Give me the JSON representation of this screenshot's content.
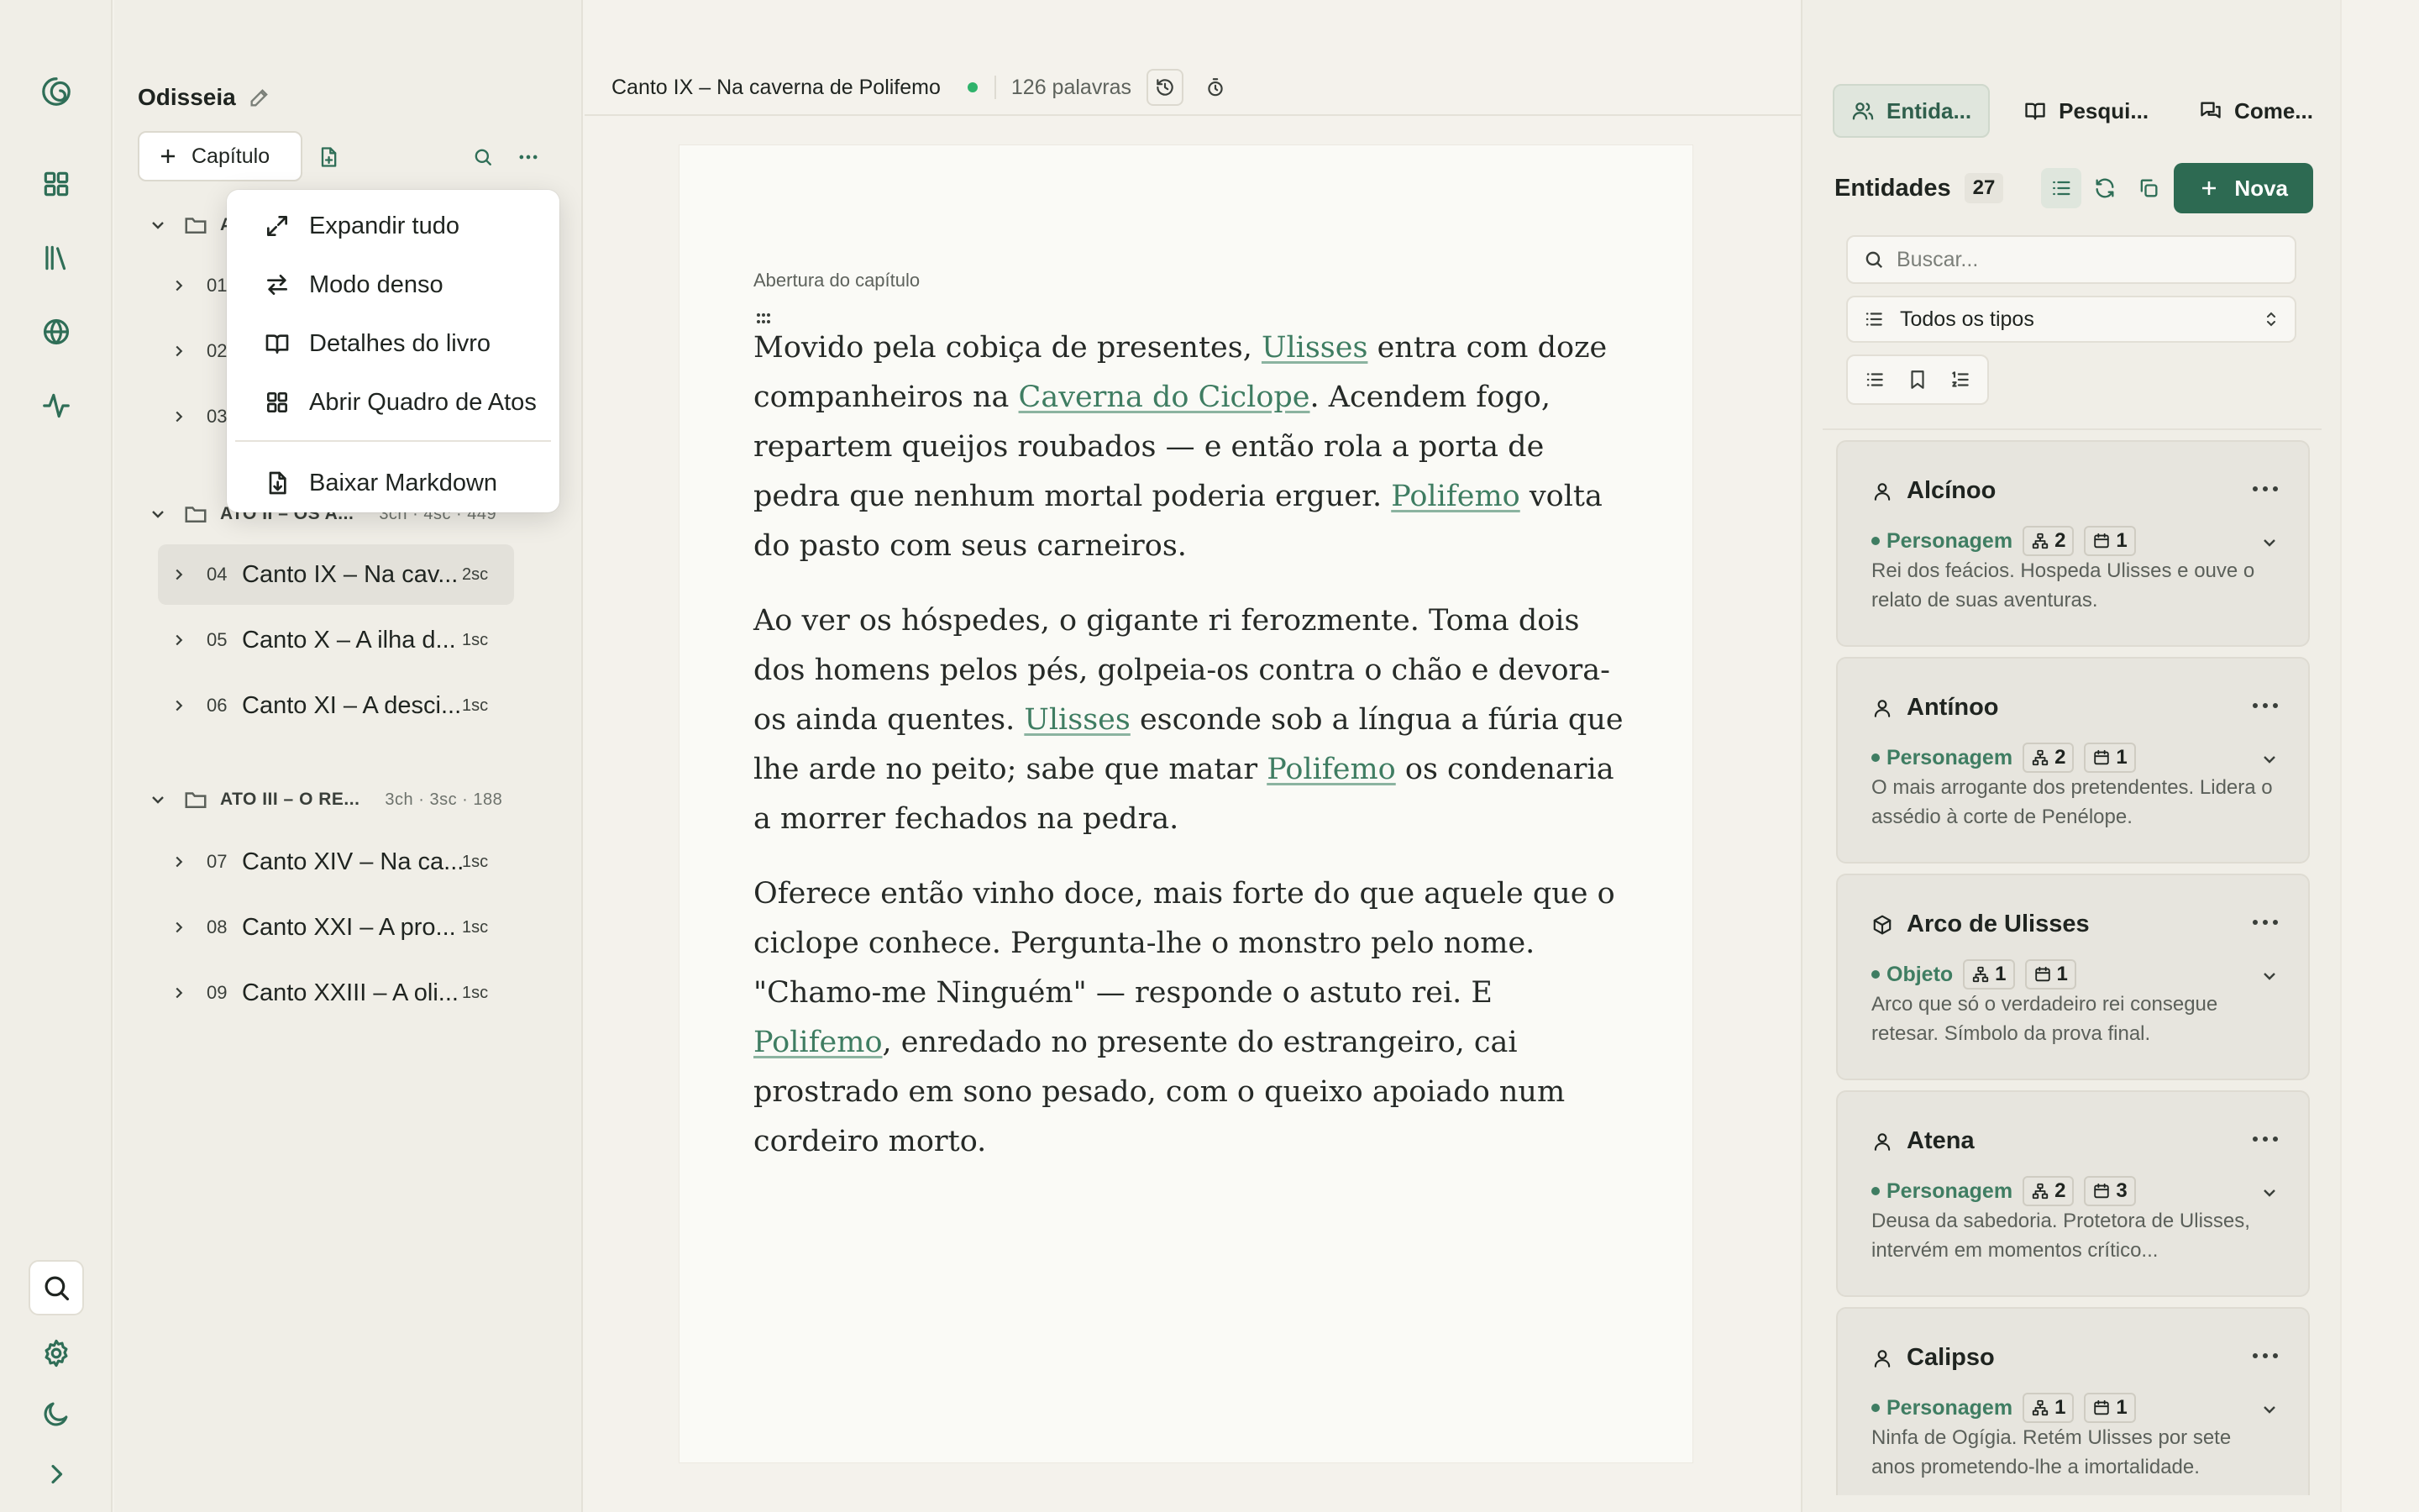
{
  "colors": {
    "accent": "#2d6a52",
    "link": "#3f7d62",
    "status_dot": "#2fb36b"
  },
  "rail": {
    "items": [
      {
        "name": "logo-icon"
      },
      {
        "name": "dashboard-icon"
      },
      {
        "name": "library-icon"
      },
      {
        "name": "globe-icon"
      },
      {
        "name": "activity-icon"
      }
    ],
    "bottom": [
      "search-icon",
      "settings-icon",
      "moon-icon",
      "chevron-right-icon"
    ]
  },
  "sidebar": {
    "book_title": "Odisseia",
    "add_chapter_label": "Capítulo",
    "acts": [
      {
        "title": "A",
        "meta": ""
      },
      {
        "title": "ATO II – OS A...",
        "meta": "3ch · 4sc · 449"
      },
      {
        "title": "ATO III – O RE...",
        "meta": "3ch · 3sc · 188"
      }
    ],
    "chapters": [
      {
        "num": "01",
        "title": "",
        "sc": ""
      },
      {
        "num": "02",
        "title": "",
        "sc": ""
      },
      {
        "num": "03",
        "title": "",
        "sc": ""
      },
      {
        "num": "04",
        "title": "Canto IX – Na cav...",
        "sc": "2sc"
      },
      {
        "num": "05",
        "title": "Canto X – A ilha d...",
        "sc": "1sc"
      },
      {
        "num": "06",
        "title": "Canto XI – A desci...",
        "sc": "1sc"
      },
      {
        "num": "07",
        "title": "Canto XIV – Na ca...",
        "sc": "1sc"
      },
      {
        "num": "08",
        "title": "Canto XXI – A pro...",
        "sc": "1sc"
      },
      {
        "num": "09",
        "title": "Canto XXIII – A oli...",
        "sc": "1sc"
      }
    ]
  },
  "menu": {
    "items": [
      {
        "label": "Expandir tudo",
        "icon": "expand-icon"
      },
      {
        "label": "Modo denso",
        "icon": "arrows-icon"
      },
      {
        "label": "Detalhes do livro",
        "icon": "book-open-icon"
      },
      {
        "label": "Abrir Quadro de Atos",
        "icon": "grid-icon"
      },
      {
        "label": "Baixar Markdown",
        "icon": "file-download-icon"
      }
    ]
  },
  "editor": {
    "chapter_title": "Canto IX – Na caverna de Polifemo",
    "word_count": "126 palavras",
    "scene_label": "Abertura do capítulo",
    "paragraphs": [
      [
        {
          "t": "Movido pela cobiça de presentes, "
        },
        {
          "t": "Ulisses",
          "link": true
        },
        {
          "t": " entra com doze companheiros na "
        },
        {
          "t": "Caverna do Ciclope",
          "link": true
        },
        {
          "t": ". Acendem fogo, repartem queijos roubados — e então rola a porta de pedra que nenhum mortal poderia erguer. "
        },
        {
          "t": "Polifemo",
          "link": true
        },
        {
          "t": " volta do pasto com seus carneiros."
        }
      ],
      [
        {
          "t": "Ao ver os hóspedes, o gigante ri ferozmente. Toma dois dos homens pelos pés, golpeia-os contra o chão e devora-os ainda quentes. "
        },
        {
          "t": "Ulisses",
          "link": true
        },
        {
          "t": " esconde sob a língua a fúria que lhe arde no peito; sabe que matar "
        },
        {
          "t": "Polifemo",
          "link": true
        },
        {
          "t": " os condenaria a morrer fechados na pedra."
        }
      ],
      [
        {
          "t": "Oferece então vinho doce, mais forte do que aquele que o ciclope conhece. Pergunta-lhe o monstro pelo nome. \"Chamo-me Ninguém\" — responde o astuto rei. E "
        },
        {
          "t": "Polifemo",
          "link": true
        },
        {
          "t": ", enredado no presente do estrangeiro, cai prostrado em sono pesado, com o queixo apoiado num cordeiro morto."
        }
      ]
    ]
  },
  "right_panel": {
    "tabs": [
      {
        "label": "Entida...",
        "icon": "users-icon",
        "active": true
      },
      {
        "label": "Pesqui...",
        "icon": "book-icon",
        "active": false
      },
      {
        "label": "Come...",
        "icon": "comments-icon",
        "active": false
      }
    ],
    "header": "Entidades",
    "count": "27",
    "new_button": "Nova",
    "search_placeholder": "Buscar...",
    "type_filter": "Todos os tipos",
    "entities": [
      {
        "name": "Alcínoo",
        "icon": "person-icon",
        "type": "Personagem",
        "rel": "2",
        "scenes": "1",
        "desc": "Rei dos feácios. Hospeda Ulisses e ouve o relato de suas aventuras."
      },
      {
        "name": "Antínoo",
        "icon": "person-icon",
        "type": "Personagem",
        "rel": "2",
        "scenes": "1",
        "desc": "O mais arrogante dos pretendentes. Lidera o assédio à corte de Penélope."
      },
      {
        "name": "Arco de Ulisses",
        "icon": "box-icon",
        "type": "Objeto",
        "rel": "1",
        "scenes": "1",
        "desc": "Arco que só o verdadeiro rei consegue retesar. Símbolo da prova final."
      },
      {
        "name": "Atena",
        "icon": "person-icon",
        "type": "Personagem",
        "rel": "2",
        "scenes": "3",
        "desc": "Deusa da sabedoria. Protetora de Ulisses, intervém em momentos crítico..."
      },
      {
        "name": "Calipso",
        "icon": "person-icon",
        "type": "Personagem",
        "rel": "1",
        "scenes": "1",
        "desc": "Ninfa de Ogígia. Retém Ulisses por sete anos prometendo-lhe a imortalidade."
      }
    ]
  }
}
